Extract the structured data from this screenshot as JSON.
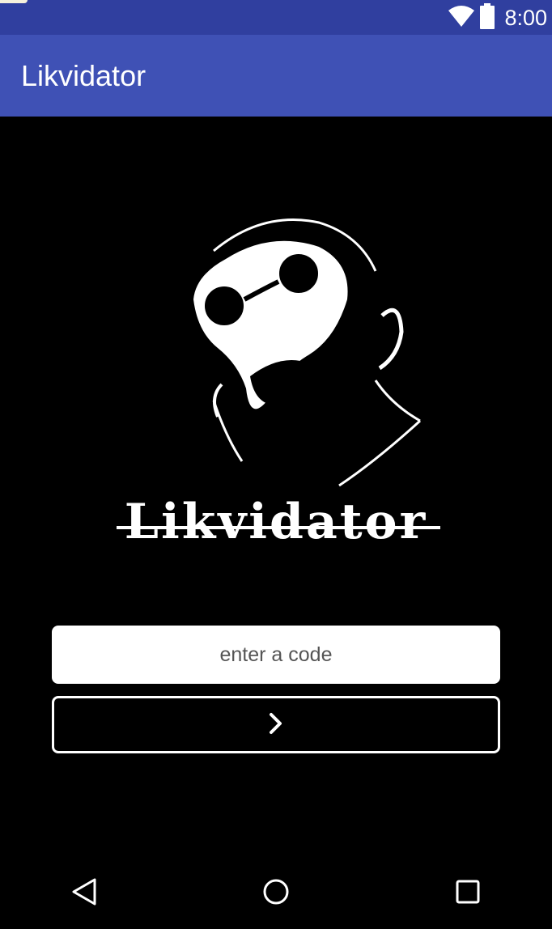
{
  "status_bar": {
    "time": "8:00",
    "icons": [
      "wifi-icon",
      "battery-icon"
    ]
  },
  "app_bar": {
    "title": "Likvidator"
  },
  "logo": {
    "text": "Likvidator"
  },
  "form": {
    "code_placeholder": "enter a code",
    "code_value": "",
    "submit_icon": "chevron-right-icon"
  },
  "nav_bar": {
    "icons": [
      "back-icon",
      "home-icon",
      "recents-icon"
    ]
  },
  "colors": {
    "status_bar": "#303F9F",
    "app_bar": "#3F51B5",
    "background": "#000000",
    "foreground": "#ffffff"
  }
}
